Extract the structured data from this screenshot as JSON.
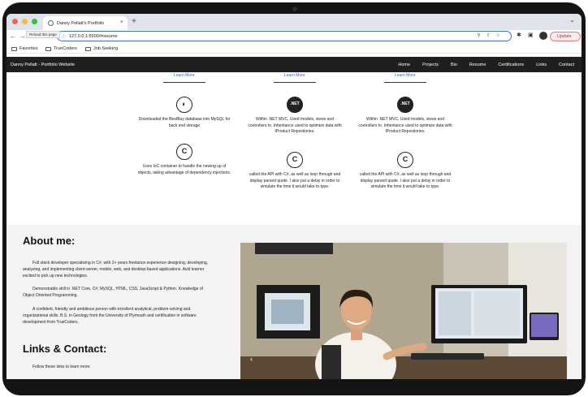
{
  "browser": {
    "tab_title": "Danny Pellatt's Portfolio",
    "tab_close": "×",
    "new_tab": "+",
    "tooltip": "Reload this page",
    "url": "127.0.0.1:5500/#resume",
    "update_label": "Update",
    "bookmarks": [
      "Favorites",
      "TrueCoders",
      "Job Seeking"
    ],
    "colors": {
      "red": "#ff5f57",
      "yellow": "#febc2e",
      "green": "#28c840",
      "accent": "#3b6fd4"
    }
  },
  "site": {
    "brand": "Danny Pellatt - Portfolio Website",
    "nav": [
      "Home",
      "Projects",
      "Bio",
      "Resume",
      "Certifications",
      "Links",
      "Contact"
    ]
  },
  "projects": {
    "learn_more": "Learn More",
    "cards": [
      {
        "icon": "mysql-icon",
        "text": "Downloaded the BestBuy database into MySQL for back end storage"
      },
      {
        "icon": "dotnet-icon",
        "text": "Within .NET MVC, Used models, views and controllers to. Inheritance used to optimize data with IProduct Repositories."
      },
      {
        "icon": "dotnet-icon",
        "text": "Within .NET MVC, Used models, views and controllers to. Inheritance used to optimize data with IProduct Repositories."
      },
      {
        "icon": "csharp-icon",
        "text": "Uses IoC container to handle the newing up of objects, taking advantage of dependency injections."
      },
      {
        "icon": "csharp-icon",
        "text": "called the API with C#, as well as loop through and display parsed quote. I also put a delay in order to simulate the time it would take to type."
      },
      {
        "icon": "csharp-icon",
        "text": "called the API with C#, as well as loop through and display parsed quote. I also put a delay in order to simulate the time it would take to type."
      }
    ]
  },
  "about": {
    "heading": "About me:",
    "paragraphs": [
      "Full stack developer specializing in C#, with 2+ years freelance experience designing, developing, analyzing, and implementing client-server, mobile, web, and desktop-based applications. Avid learner excited to pick up new technologies.",
      "Demonstrable skill in .NET Core, C#, MySQL, HTML, CSS, JavaScript & Python. Knowledge of Object Oriented Programming.",
      "A confident, friendly and ambitious person with excellent analytical, problem-solving and organizational skills. B.S. in Geology from the University of Plymouth and certification in software development from TrueCoders."
    ],
    "links_heading": "Links & Contact:",
    "follow_text": "Follow these links to learn more:"
  }
}
